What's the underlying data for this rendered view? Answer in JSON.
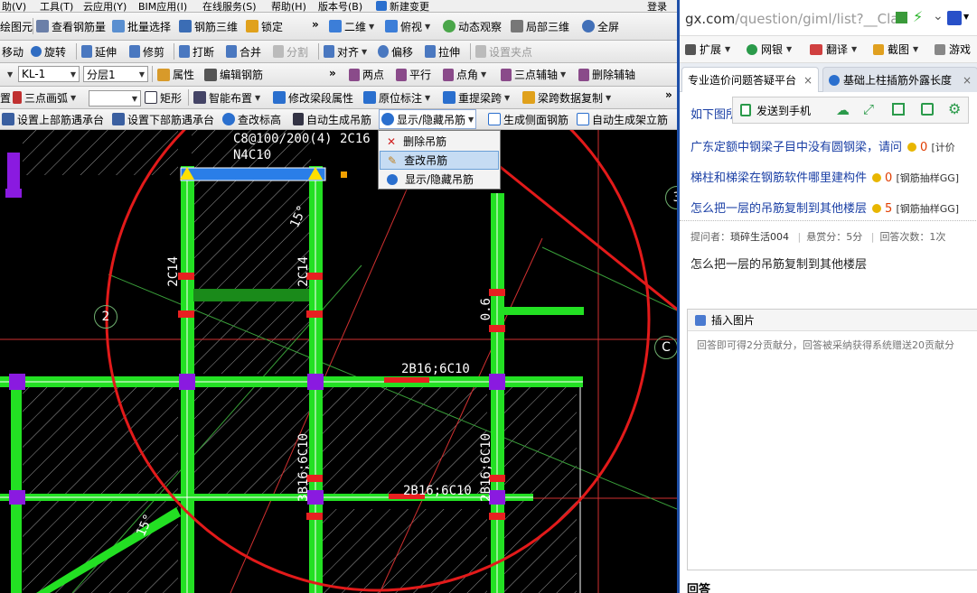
{
  "cad": {
    "menubar": [
      "助(V)",
      "工具(T)",
      "云应用(Y)",
      "BIM应用(I)",
      "在线服务(S)",
      "帮助(H)",
      "版本号(B)",
      "新建变更",
      "登录"
    ],
    "toolbar1": {
      "items": [
        "绘图元",
        "查看钢筋量",
        "批量选择",
        "钢筋三维",
        "锁定"
      ],
      "right": [
        "二维",
        "俯视",
        "动态观察",
        "局部三维",
        "全屏"
      ]
    },
    "toolbar2": [
      "移动",
      "旋转",
      "延伸",
      "修剪",
      "打断",
      "合并",
      "分割",
      "对齐",
      "偏移",
      "拉伸",
      "设置夹点"
    ],
    "toolbar3": {
      "combo1": "KL-1",
      "combo2": "分层1",
      "items": [
        "属性",
        "编辑钢筋",
        "两点",
        "平行",
        "点角",
        "三点辅轴",
        "删除辅轴"
      ]
    },
    "toolbar4": [
      "三点画弧",
      "矩形",
      "智能布置",
      "修改梁段属性",
      "原位标注",
      "重提梁跨",
      "梁跨数据复制"
    ],
    "toolbar4_prefix": "置",
    "toolbar5": [
      "设置上部筋遇承台",
      "设置下部筋遇承台",
      "查改标高",
      "自动生成吊筋",
      "显示/隐藏吊筋",
      "生成侧面钢筋",
      "自动生成架立筋"
    ],
    "dropdown": [
      "删除吊筋",
      "查改吊筋",
      "显示/隐藏吊筋"
    ],
    "canvas": {
      "texts": [
        "C8@100/200(4) 2C16",
        "N4C10",
        "2C14",
        "2C14",
        "2B16;6C10",
        "2B16;6C10",
        "3B16;6C10",
        "2B16;6C10",
        "15°",
        "15°",
        "0.6"
      ],
      "grid_labels": [
        "2",
        "C",
        "3"
      ]
    }
  },
  "browser": {
    "url_main": "gx.com",
    "url_path": "/question/giml/list?__Clas",
    "bookmarks": [
      "扩展",
      "网银",
      "翻译",
      "截图",
      "游戏"
    ],
    "tabs": [
      "专业造价问题答疑平台",
      "基础上柱插筋外露长度"
    ],
    "send_to_phone": "发送到手机",
    "partial_link": "如下图所",
    "questions": [
      {
        "title": "广东定额中钢梁子目中没有圆钢梁，请问",
        "count": "0",
        "tag": "[计价"
      },
      {
        "title": "梯柱和梯梁在钢筋软件哪里建构件",
        "count": "0",
        "tag": "[钢筋抽样GG]"
      },
      {
        "title": "怎么把一层的吊筋复制到其他楼层",
        "count": "5",
        "tag": "[钢筋抽样GG]"
      }
    ],
    "meta": {
      "asker_label": "提问者：",
      "asker": "琐碎生活004",
      "reward": "悬赏分：5分",
      "answers": "回答次数：1次"
    },
    "question_body": "怎么把一层的吊筋复制到其他楼层",
    "insert_image": "插入图片",
    "placeholder": "回答即可得2分贡献分，回答被采纳获得系统赠送20贡献分",
    "footer_label": "回答"
  }
}
